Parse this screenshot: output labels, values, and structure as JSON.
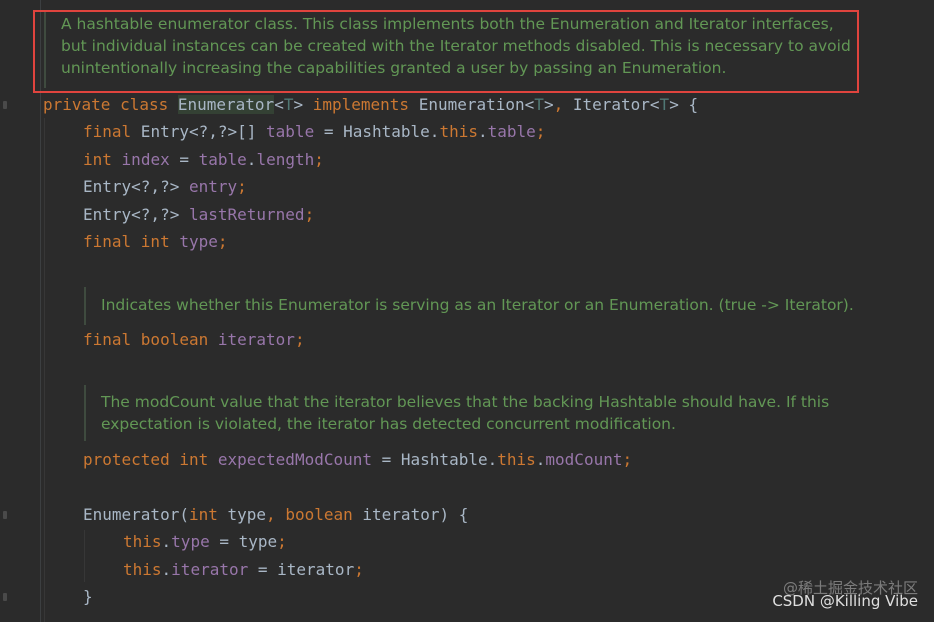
{
  "doc_comments": {
    "class_doc": [
      "A hashtable enumerator class. This class implements both the Enumeration and Iterator interfaces,",
      "but individual instances can be created with the Iterator methods disabled. This is necessary to avoid",
      "unintentionally increasing the capabilities granted a user by passing an Enumeration."
    ],
    "iterator_doc": [
      "Indicates whether this Enumerator is serving as an Iterator or an Enumeration. (true -> Iterator)."
    ],
    "modcount_doc": [
      "The modCount value that the iterator believes that the backing Hashtable should have. If this",
      "expectation is violated, the iterator has detected concurrent modification."
    ]
  },
  "code": {
    "l1": {
      "private_class": "private class ",
      "class_name": "Enumerator",
      "t1": "<",
      "t2": "T",
      "t3": "> ",
      "implements": "implements",
      "rest1": " Enumeration<",
      "t4": "T",
      "rest2": ">",
      "comma": ",",
      "rest3": " Iterator<",
      "t5": "T",
      "rest4": "> {"
    },
    "l2": {
      "kw": "final",
      "type": " Entry<?,?>[] ",
      "field": "table",
      "eq": " = Hashtable.",
      "this": "this",
      "dot": ".",
      "field2": "table",
      "semi": ";"
    },
    "l3": {
      "kw": "int",
      "sp": " ",
      "field": "index",
      "eq": " = ",
      "field2": "table",
      "dot": ".",
      "field3": "length",
      "semi": ";"
    },
    "l4": {
      "type": "Entry<?,?> ",
      "field": "entry",
      "semi": ";"
    },
    "l5": {
      "type": "Entry<?,?> ",
      "field": "lastReturned",
      "semi": ";"
    },
    "l6": {
      "kw": "final int",
      "sp": " ",
      "field": "type",
      "semi": ";"
    },
    "l7": {
      "kw": "final boolean",
      "sp": " ",
      "field": "iterator",
      "semi": ";"
    },
    "l8": {
      "kw": "protected int",
      "sp": " ",
      "field": "expectedModCount",
      "eq": " = Hashtable.",
      "this": "this",
      "dot": ".",
      "field2": "modCount",
      "semi": ";"
    },
    "l9": {
      "name": "Enumerator(",
      "kw1": "int",
      "p1": " type",
      "comma": ",",
      "sp": " ",
      "kw2": "boolean",
      "p2": " iterator) {"
    },
    "l10": {
      "this": "this",
      "dot": ".",
      "field": "type",
      "eq": " = type",
      "semi": ";"
    },
    "l11": {
      "this": "this",
      "dot": ".",
      "field": "iterator",
      "eq": " = iterator",
      "semi": ";"
    },
    "l12": {
      "brace": "}"
    }
  },
  "watermark": {
    "line1": "@稀土掘金技术社区",
    "line2": "CSDN @Killing Vibe"
  },
  "colors": {
    "background": "#2b2b2b",
    "keyword": "#cc7832",
    "field": "#9876aa",
    "plain": "#a9b7c6",
    "doc_comment": "#629755",
    "highlight_border": "#e0443e"
  }
}
